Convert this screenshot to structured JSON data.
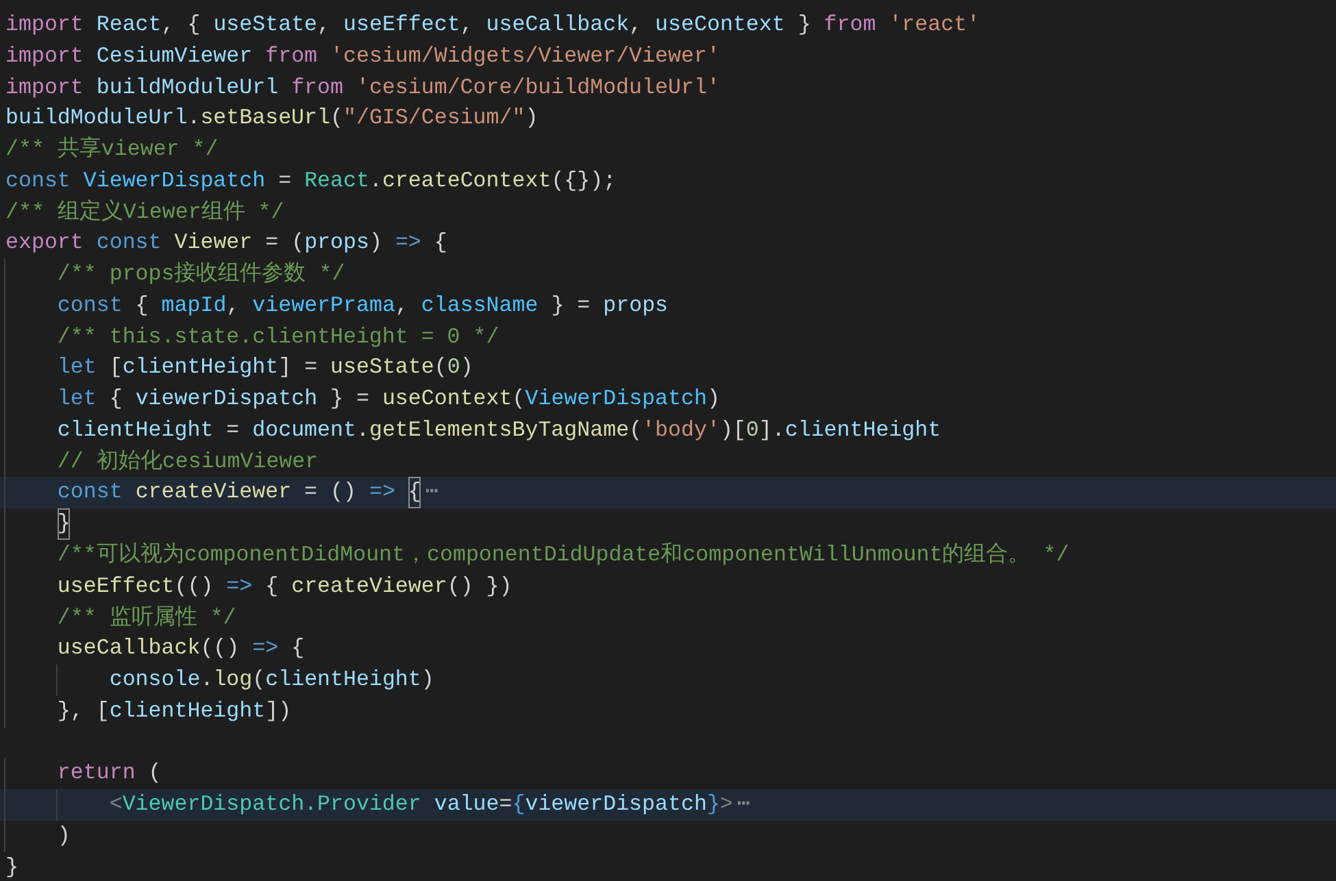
{
  "editor": {
    "lines": [
      {
        "highlighted": false,
        "tokens": [
          {
            "text": "import ",
            "kind": "kw"
          },
          {
            "text": "React",
            "kind": "v"
          },
          {
            "text": ", { ",
            "kind": "p"
          },
          {
            "text": "useState",
            "kind": "v"
          },
          {
            "text": ", ",
            "kind": "p"
          },
          {
            "text": "useEffect",
            "kind": "v"
          },
          {
            "text": ", ",
            "kind": "p"
          },
          {
            "text": "useCallback",
            "kind": "v"
          },
          {
            "text": ", ",
            "kind": "p"
          },
          {
            "text": "useContext",
            "kind": "v"
          },
          {
            "text": " } ",
            "kind": "p"
          },
          {
            "text": "from ",
            "kind": "kw"
          },
          {
            "text": "'react'",
            "kind": "s"
          }
        ]
      },
      {
        "highlighted": false,
        "tokens": [
          {
            "text": "import ",
            "kind": "kw"
          },
          {
            "text": "CesiumViewer ",
            "kind": "v"
          },
          {
            "text": "from ",
            "kind": "kw"
          },
          {
            "text": "'cesium/Widgets/Viewer/Viewer'",
            "kind": "s"
          }
        ]
      },
      {
        "highlighted": false,
        "tokens": [
          {
            "text": "import ",
            "kind": "kw"
          },
          {
            "text": "buildModuleUrl ",
            "kind": "v"
          },
          {
            "text": "from ",
            "kind": "kw"
          },
          {
            "text": "'cesium/Core/buildModuleUrl'",
            "kind": "s"
          }
        ]
      },
      {
        "highlighted": false,
        "tokens": [
          {
            "text": "buildModuleUrl",
            "kind": "v"
          },
          {
            "text": ".",
            "kind": "p"
          },
          {
            "text": "setBaseUrl",
            "kind": "fn"
          },
          {
            "text": "(",
            "kind": "p"
          },
          {
            "text": "\"/GIS/Cesium/\"",
            "kind": "s"
          },
          {
            "text": ")",
            "kind": "p"
          }
        ]
      },
      {
        "highlighted": false,
        "tokens": [
          {
            "text": "/** 共享viewer */",
            "kind": "c"
          }
        ]
      },
      {
        "highlighted": false,
        "tokens": [
          {
            "text": "const ",
            "kind": "st"
          },
          {
            "text": "ViewerDispatch",
            "kind": "k"
          },
          {
            "text": " = ",
            "kind": "p"
          },
          {
            "text": "React",
            "kind": "t"
          },
          {
            "text": ".",
            "kind": "p"
          },
          {
            "text": "createContext",
            "kind": "fn"
          },
          {
            "text": "({});",
            "kind": "p"
          }
        ]
      },
      {
        "highlighted": false,
        "tokens": [
          {
            "text": "/** 组定义Viewer组件 */",
            "kind": "c"
          }
        ]
      },
      {
        "highlighted": false,
        "tokens": [
          {
            "text": "export ",
            "kind": "kw"
          },
          {
            "text": "const ",
            "kind": "st"
          },
          {
            "text": "Viewer",
            "kind": "fn"
          },
          {
            "text": " = (",
            "kind": "p"
          },
          {
            "text": "props",
            "kind": "v"
          },
          {
            "text": ") ",
            "kind": "p"
          },
          {
            "text": "=>",
            "kind": "st"
          },
          {
            "text": " {",
            "kind": "p"
          }
        ]
      },
      {
        "highlighted": false,
        "tokens": [
          {
            "text": "    /** props接收组件参数 */",
            "kind": "c"
          }
        ]
      },
      {
        "highlighted": false,
        "tokens": [
          {
            "text": "    const",
            "kind": "st"
          },
          {
            "text": " { ",
            "kind": "p"
          },
          {
            "text": "mapId",
            "kind": "k"
          },
          {
            "text": ", ",
            "kind": "p"
          },
          {
            "text": "viewerPrama",
            "kind": "k"
          },
          {
            "text": ", ",
            "kind": "p"
          },
          {
            "text": "className",
            "kind": "k"
          },
          {
            "text": " } = ",
            "kind": "p"
          },
          {
            "text": "props",
            "kind": "v"
          }
        ]
      },
      {
        "highlighted": false,
        "tokens": [
          {
            "text": "    /** this.state.clientHeight = 0 */",
            "kind": "c"
          }
        ]
      },
      {
        "highlighted": false,
        "tokens": [
          {
            "text": "    let",
            "kind": "st"
          },
          {
            "text": " [",
            "kind": "p"
          },
          {
            "text": "clientHeight",
            "kind": "v"
          },
          {
            "text": "] = ",
            "kind": "p"
          },
          {
            "text": "useState",
            "kind": "fn"
          },
          {
            "text": "(",
            "kind": "p"
          },
          {
            "text": "0",
            "kind": "n"
          },
          {
            "text": ")",
            "kind": "p"
          }
        ]
      },
      {
        "highlighted": false,
        "tokens": [
          {
            "text": "    let",
            "kind": "st"
          },
          {
            "text": " { ",
            "kind": "p"
          },
          {
            "text": "viewerDispatch",
            "kind": "v"
          },
          {
            "text": " } = ",
            "kind": "p"
          },
          {
            "text": "useContext",
            "kind": "fn"
          },
          {
            "text": "(",
            "kind": "p"
          },
          {
            "text": "ViewerDispatch",
            "kind": "k"
          },
          {
            "text": ")",
            "kind": "p"
          }
        ]
      },
      {
        "highlighted": false,
        "tokens": [
          {
            "text": "    clientHeight",
            "kind": "v"
          },
          {
            "text": " = ",
            "kind": "p"
          },
          {
            "text": "document",
            "kind": "v"
          },
          {
            "text": ".",
            "kind": "p"
          },
          {
            "text": "getElementsByTagName",
            "kind": "fn"
          },
          {
            "text": "(",
            "kind": "p"
          },
          {
            "text": "'body'",
            "kind": "s"
          },
          {
            "text": ")[",
            "kind": "p"
          },
          {
            "text": "0",
            "kind": "n"
          },
          {
            "text": "].",
            "kind": "p"
          },
          {
            "text": "clientHeight",
            "kind": "v"
          }
        ]
      },
      {
        "highlighted": false,
        "tokens": [
          {
            "text": "    // 初始化cesiumViewer",
            "kind": "c"
          }
        ]
      },
      {
        "highlighted": true,
        "tokens": [
          {
            "text": "    const ",
            "kind": "st"
          },
          {
            "text": "createViewer",
            "kind": "fn"
          },
          {
            "text": " = () ",
            "kind": "p"
          },
          {
            "text": "=> ",
            "kind": "st"
          },
          {
            "text": "{",
            "kind": "bm"
          },
          {
            "text": "⋯",
            "kind": "f"
          }
        ]
      },
      {
        "highlighted": false,
        "tokens": [
          {
            "text": "    }",
            "kind": "bm"
          }
        ]
      },
      {
        "highlighted": false,
        "tokens": [
          {
            "text": "    /**可以视为componentDidMount，componentDidUpdate和componentWillUnmount的组合。 */",
            "kind": "c"
          }
        ]
      },
      {
        "highlighted": false,
        "tokens": [
          {
            "text": "    useEffect",
            "kind": "fn"
          },
          {
            "text": "(() ",
            "kind": "p"
          },
          {
            "text": "=>",
            "kind": "st"
          },
          {
            "text": " { ",
            "kind": "p"
          },
          {
            "text": "createViewer",
            "kind": "fn"
          },
          {
            "text": "() })",
            "kind": "p"
          }
        ]
      },
      {
        "highlighted": false,
        "tokens": [
          {
            "text": "    /** 监听属性 */",
            "kind": "c"
          }
        ]
      },
      {
        "highlighted": false,
        "tokens": [
          {
            "text": "    useCallback",
            "kind": "fn"
          },
          {
            "text": "(() ",
            "kind": "p"
          },
          {
            "text": "=>",
            "kind": "st"
          },
          {
            "text": " {",
            "kind": "p"
          }
        ]
      },
      {
        "highlighted": false,
        "tokens": [
          {
            "text": "        console",
            "kind": "v"
          },
          {
            "text": ".",
            "kind": "p"
          },
          {
            "text": "log",
            "kind": "fn"
          },
          {
            "text": "(",
            "kind": "p"
          },
          {
            "text": "clientHeight",
            "kind": "v"
          },
          {
            "text": ")",
            "kind": "p"
          }
        ]
      },
      {
        "highlighted": false,
        "tokens": [
          {
            "text": "    }, [",
            "kind": "p"
          },
          {
            "text": "clientHeight",
            "kind": "v"
          },
          {
            "text": "])",
            "kind": "p"
          }
        ]
      },
      {
        "highlighted": false
      },
      {
        "highlighted": false,
        "tokens": [
          {
            "text": "    return",
            "kind": "kw"
          },
          {
            "text": " (",
            "kind": "p"
          }
        ]
      },
      {
        "highlighted": true,
        "tokens": [
          {
            "text": "        <",
            "kind": "g"
          },
          {
            "text": "ViewerDispatch.Provider ",
            "kind": "t"
          },
          {
            "text": "value",
            "kind": "v"
          },
          {
            "text": "=",
            "kind": "p"
          },
          {
            "text": "{",
            "kind": "st"
          },
          {
            "text": "viewerDispatch",
            "kind": "v"
          },
          {
            "text": "}",
            "kind": "st"
          },
          {
            "text": ">",
            "kind": "g"
          },
          {
            "text": "⋯",
            "kind": "f"
          }
        ]
      },
      {
        "highlighted": false,
        "tokens": [
          {
            "text": "    )",
            "kind": "p"
          }
        ]
      },
      {
        "highlighted": false,
        "tokens": [
          {
            "text": "}",
            "kind": "p"
          }
        ]
      }
    ]
  }
}
